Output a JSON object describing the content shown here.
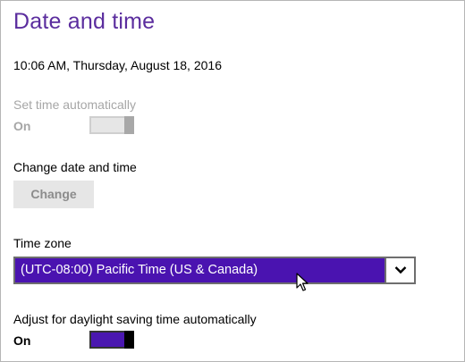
{
  "page": {
    "title": "Date and time",
    "current_datetime": "10:06 AM, Thursday, August 18, 2016"
  },
  "set_time_automatically": {
    "label": "Set time automatically",
    "state": "On"
  },
  "change_date_time": {
    "label": "Change date and time",
    "button_label": "Change"
  },
  "time_zone": {
    "label": "Time zone",
    "selected": "(UTC-08:00) Pacific Time (US & Canada)"
  },
  "daylight_saving": {
    "label": "Adjust for daylight saving time automatically",
    "state": "On"
  },
  "colors": {
    "title": "#5b2d9e",
    "accent": "#4a13b0",
    "disabled_text": "#a6a6a6"
  },
  "icons": {
    "dropdown": "chevron-down-icon",
    "pointer": "mouse-cursor-icon"
  }
}
